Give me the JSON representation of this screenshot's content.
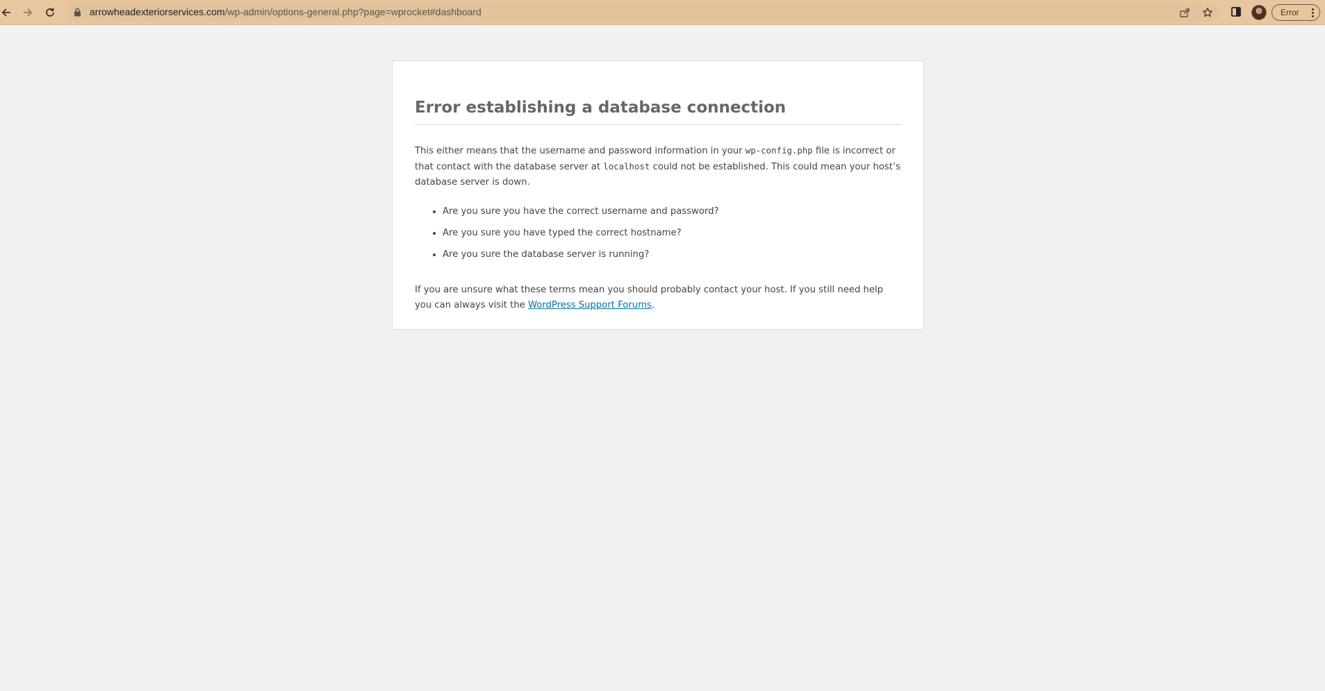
{
  "browser": {
    "url_host": "arrowheadexteriorservices.com",
    "url_path": "/wp-admin/options-general.php?page=wprocket#dashboard",
    "profile_chip_label": "Error",
    "icons": [
      "back-arrow-icon",
      "forward-arrow-icon",
      "reload-icon",
      "lock-icon",
      "share-icon",
      "star-icon",
      "side-panel-icon",
      "kebab-menu-icon"
    ]
  },
  "error": {
    "title": "Error establishing a database connection",
    "intro_part1": "This either means that the username and password information in your ",
    "config_file": "wp-config.php",
    "intro_part2": " file is incorrect or that contact with the database server at ",
    "db_host": "localhost",
    "intro_part3": " could not be established. This could mean your host’s database server is down.",
    "checklist": [
      "Are you sure you have the correct username and password?",
      "Are you sure you have typed the correct hostname?",
      "Are you sure the database server is running?"
    ],
    "help_text": "If you are unsure what these terms mean you should probably contact your host. If you still need help you can always visit the ",
    "help_link_label": "WordPress Support Forums",
    "help_suffix": "."
  },
  "colors": {
    "toolbar_bg": "#e8c6a0",
    "page_bg": "#f1f1f1",
    "link": "#0073aa",
    "title": "#666666"
  }
}
